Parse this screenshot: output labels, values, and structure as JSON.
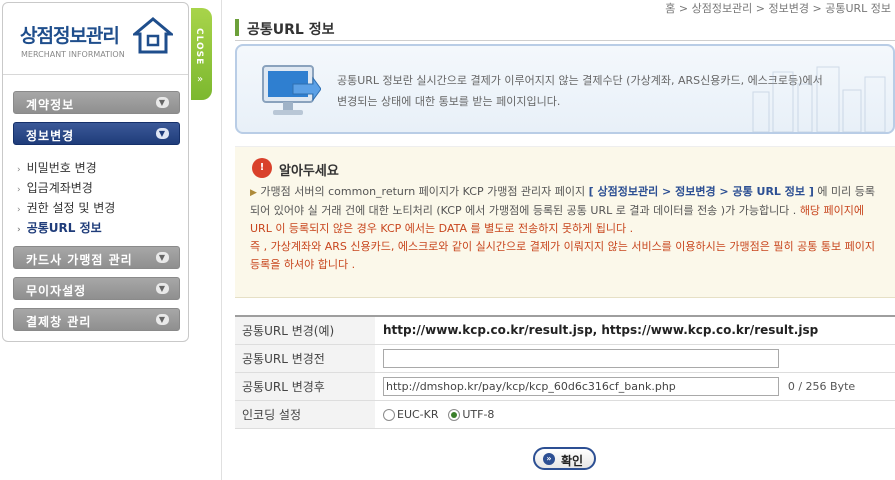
{
  "sidebar": {
    "logo_title": "상점정보관리",
    "logo_subtitle": "MERCHANT INFORMATION",
    "menu": [
      {
        "label": "계약정보"
      },
      {
        "label": "정보변경"
      },
      {
        "label": "카드사 가맹점 관리"
      },
      {
        "label": "무이자설정"
      },
      {
        "label": "결제창 관리"
      }
    ],
    "sub_items": [
      {
        "label": "비밀번호 변경"
      },
      {
        "label": "입금계좌변경"
      },
      {
        "label": "권한 설정 및 변경"
      },
      {
        "label": "공통URL 정보"
      }
    ],
    "close_label": "CLOSE",
    "close_arrow": "»"
  },
  "breadcrumb": "홈 > 상점정보관리 > 정보변경 > 공통URL 정보",
  "page_title": "공통URL 정보",
  "info": {
    "line1": "공통URL 정보란 실시간으로 결제가 이루어지지 않는 결제수단 (가상계좌, ARS신용카드, 에스크로등)에서",
    "line2": "변경되는 상태에 대한 통보를 받는 페이지입니다."
  },
  "notice": {
    "title": "알아두세요",
    "part1": "가맹점 서버의 common_return 페이지가 KCP 가맹점 관리자 페이지",
    "highlight": "[ 상점정보관리 > 정보변경 > 공통 URL 정보 ]",
    "part2": "에 미리 등록되어 있어야 실 거래 건에 대한 노티처리 (KCP 에서 가맹점에 등록된 공통 URL 로 결과 데이터를 전송 )가 가능합니다 .",
    "red1": "해당 페이지에 URL 이 등록되지 않은 경우 KCP 에서는 DATA 를 별도로 전송하지 못하게 됩니다 .",
    "red2": "즉 , 가상계좌와 ARS 신용카드, 에스크로와 같이 실시간으로 결제가 이뤄지지 않는 서비스를 이용하시는 가맹점은 필히 공통 통보 페이지 등록을 하셔야 합니다 ."
  },
  "form": {
    "example_label": "공통URL 변경(예)",
    "example_value": "http://www.kcp.co.kr/result.jsp, https://www.kcp.co.kr/result.jsp",
    "before_label": "공통URL 변경전",
    "before_value": "",
    "after_label": "공통URL 변경후",
    "after_value": "http://dmshop.kr/pay/kcp/kcp_60d6c316cf_bank.php",
    "byte_count": "0 / 256 Byte",
    "encoding_label": "인코딩 설정",
    "encoding_options": [
      "EUC-KR",
      "UTF-8"
    ],
    "encoding_selected": "UTF-8"
  },
  "confirm_label": "확인",
  "colors": {
    "accent_green": "#6ca03a",
    "active_menu": "#1f3c7a",
    "notice_red": "#c8461e"
  }
}
